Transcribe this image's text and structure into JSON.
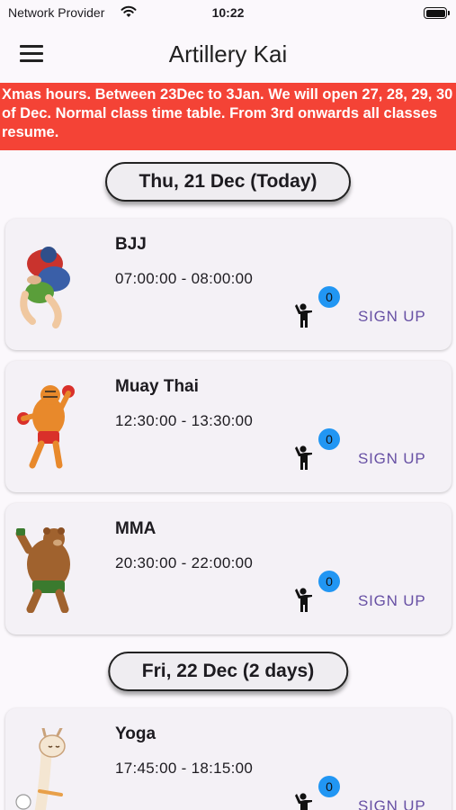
{
  "status_bar": {
    "carrier": "Network Provider",
    "time": "10:22",
    "icons": [
      "wifi-icon",
      "battery-icon"
    ]
  },
  "app_bar": {
    "title": "Artillery Kai",
    "menu_icon": "menu-icon"
  },
  "banner": {
    "text": "Xmas hours. Between 23Dec to 3Jan. We will open 27, 28, 29, 30 of Dec. Normal class time table. From 3rd onwards all classes resume.",
    "color": "#f44336"
  },
  "days": [
    {
      "label": "Thu, 21 Dec (Today)",
      "classes": [
        {
          "name": "BJJ",
          "time": "07:00:00 - 08:00:00",
          "count": "0",
          "signup_label": "SIGN UP",
          "image": "bjj-illustration"
        },
        {
          "name": "Muay Thai",
          "time": "12:30:00 - 13:30:00",
          "count": "0",
          "signup_label": "SIGN UP",
          "image": "tiger-boxer-illustration"
        },
        {
          "name": "MMA",
          "time": "20:30:00 - 22:00:00",
          "count": "0",
          "signup_label": "SIGN UP",
          "image": "bear-fighter-illustration"
        }
      ]
    },
    {
      "label": "Fri, 22 Dec (2 days)",
      "classes": [
        {
          "name": "Yoga",
          "time": "17:45:00 - 18:15:00",
          "count": "0",
          "signup_label": "SIGN UP",
          "image": "llama-yoga-illustration"
        }
      ]
    }
  ],
  "colors": {
    "accent": "#6750a4",
    "badge": "#2196f3",
    "banner": "#f44336"
  }
}
